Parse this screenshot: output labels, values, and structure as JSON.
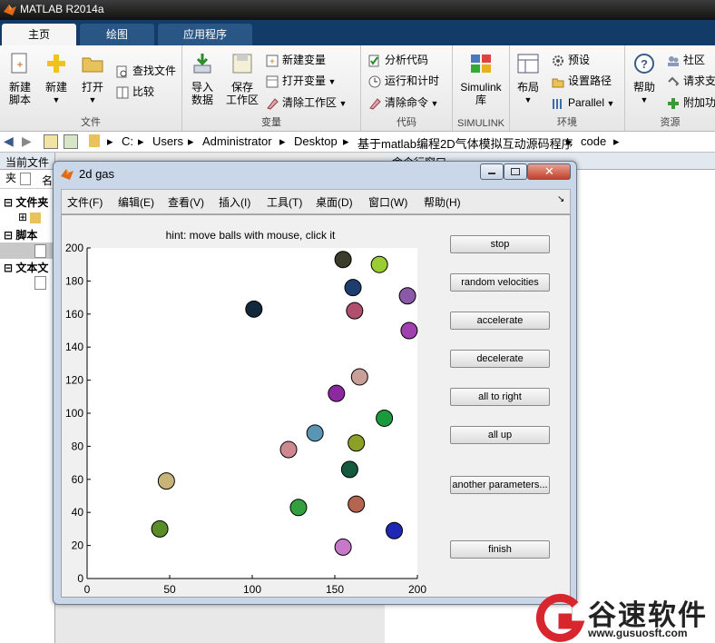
{
  "app": {
    "title": "MATLAB R2014a"
  },
  "tabs": [
    "主页",
    "绘图",
    "应用程序"
  ],
  "ribbon": {
    "file_group": {
      "label": "文件",
      "new_script": "新建\n脚本",
      "new": "新建",
      "open": "打开",
      "find_files": "查找文件",
      "compare": "比较"
    },
    "variable_group": {
      "label": "变量",
      "import_data": "导入\n数据",
      "save_workspace": "保存\n工作区",
      "new_variable": "新建变量",
      "open_variable": "打开变量",
      "clear_workspace": "清除工作区"
    },
    "code_group": {
      "label": "代码",
      "analyze_code": "分析代码",
      "run_and_time": "运行和计时",
      "clear_commands": "清除命令"
    },
    "simulink_group": {
      "label": "SIMULINK",
      "simulink_library": "Simulink\n库"
    },
    "env_group": {
      "label": "环境",
      "layout": "布局",
      "preferences": "预设",
      "set_path": "设置路径",
      "parallel": "Parallel"
    },
    "resources_group": {
      "label": "资源",
      "help": "帮助",
      "community": "社区",
      "request_support": "请求支",
      "addons": "附加功"
    }
  },
  "path": [
    "C:",
    "Users",
    "Administrator",
    "Desktop",
    "基于matlab编程2D气体模拟互动源码程序",
    "code"
  ],
  "left_panel": {
    "title": "当前文件夹",
    "name_col": "名",
    "folders_label": "文件夹",
    "scripts_label": "脚本",
    "text_files_label": "文本文"
  },
  "right_panel": {
    "title": "命令行窗口"
  },
  "figure": {
    "title": "2d gas",
    "menus": [
      "文件(F)",
      "编辑(E)",
      "查看(V)",
      "插入(I)",
      "工具(T)",
      "桌面(D)",
      "窗口(W)",
      "帮助(H)"
    ],
    "hint": "hint: move balls with mouse, click it",
    "buttons": {
      "stop": "stop",
      "random_velocities": "random velocities",
      "accelerate": "accelerate",
      "decelerate": "decelerate",
      "all_to_right": "all to right",
      "all_up": "all up",
      "another_parameters": "another parameters...",
      "finish": "finish"
    }
  },
  "chart_data": {
    "type": "scatter",
    "title": "hint: move balls with mouse, click it",
    "xlabel": "",
    "ylabel": "",
    "xlim": [
      0,
      200
    ],
    "ylim": [
      0,
      200
    ],
    "xticks": [
      0,
      50,
      100,
      150,
      200
    ],
    "yticks": [
      0,
      20,
      40,
      60,
      80,
      100,
      120,
      140,
      160,
      180,
      200
    ],
    "points": [
      {
        "x": 155,
        "y": 193,
        "color": "#3c3c2a"
      },
      {
        "x": 177,
        "y": 190,
        "color": "#9acd32"
      },
      {
        "x": 161,
        "y": 176,
        "color": "#1e3c6e"
      },
      {
        "x": 194,
        "y": 171,
        "color": "#8a5aa8"
      },
      {
        "x": 101,
        "y": 163,
        "color": "#14283c"
      },
      {
        "x": 162,
        "y": 162,
        "color": "#b0506e"
      },
      {
        "x": 195,
        "y": 150,
        "color": "#a040b0"
      },
      {
        "x": 165,
        "y": 122,
        "color": "#c8a098"
      },
      {
        "x": 151,
        "y": 112,
        "color": "#8c28a0"
      },
      {
        "x": 180,
        "y": 97,
        "color": "#1a9a3c"
      },
      {
        "x": 138,
        "y": 88,
        "color": "#5a96b4"
      },
      {
        "x": 163,
        "y": 82,
        "color": "#8ca028"
      },
      {
        "x": 122,
        "y": 78,
        "color": "#d08890"
      },
      {
        "x": 159,
        "y": 66,
        "color": "#145a3c"
      },
      {
        "x": 48,
        "y": 59,
        "color": "#c8b478"
      },
      {
        "x": 128,
        "y": 43,
        "color": "#32a03c"
      },
      {
        "x": 163,
        "y": 45,
        "color": "#b46450"
      },
      {
        "x": 44,
        "y": 30,
        "color": "#5a8c28"
      },
      {
        "x": 186,
        "y": 29,
        "color": "#1e28b4"
      },
      {
        "x": 155,
        "y": 19,
        "color": "#c878c8"
      }
    ]
  },
  "watermark": {
    "brand": "谷速软件",
    "url": "www.gusuosft.com"
  },
  "colors": {
    "ribbon_tab_bg": "#123c67",
    "figure_frame": "#c9d7e8"
  }
}
